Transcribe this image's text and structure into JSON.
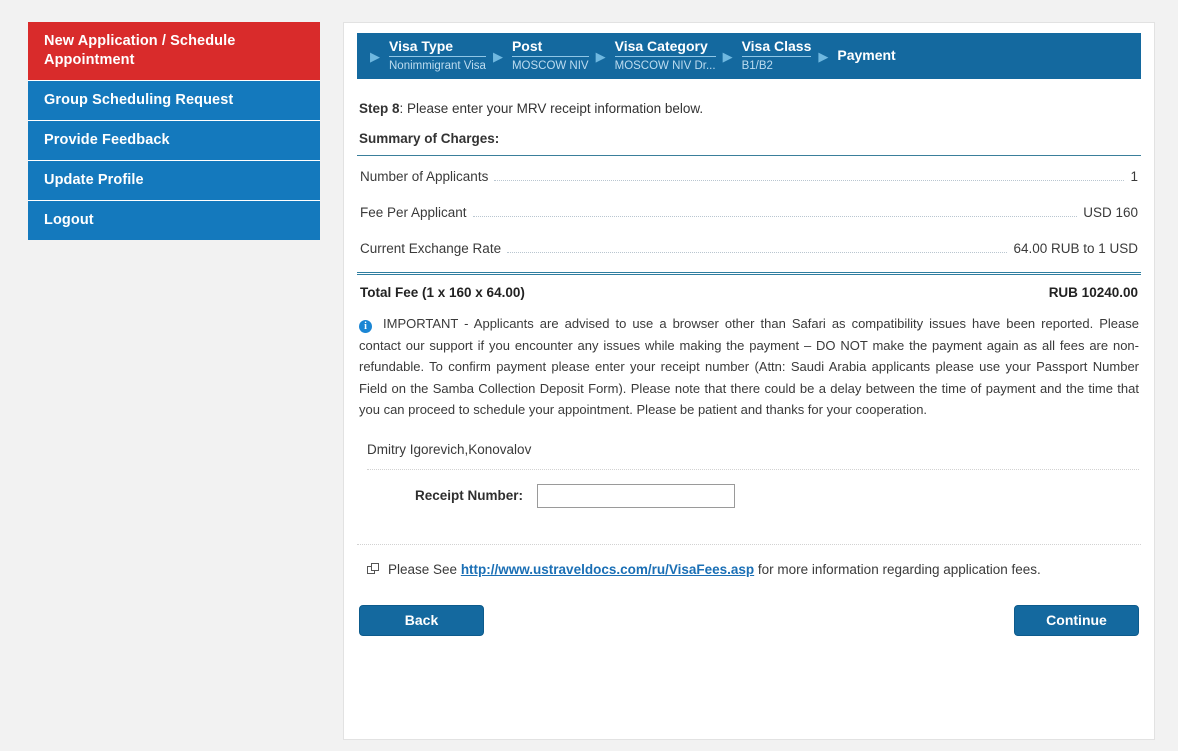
{
  "sidebar": {
    "items": [
      {
        "label": "New Application / Schedule Appointment",
        "active": true
      },
      {
        "label": "Group Scheduling Request",
        "active": false
      },
      {
        "label": "Provide Feedback",
        "active": false
      },
      {
        "label": "Update Profile",
        "active": false
      },
      {
        "label": "Logout",
        "active": false
      }
    ]
  },
  "stepper": {
    "arrow_glyph": "▶",
    "steps": [
      {
        "title": "Visa Type",
        "sub": "Nonimmigrant Visa"
      },
      {
        "title": "Post",
        "sub": "MOSCOW NIV"
      },
      {
        "title": "Visa Category",
        "sub": "MOSCOW NIV Dr..."
      },
      {
        "title": "Visa Class",
        "sub": "B1/B2"
      },
      {
        "title": "Payment",
        "sub": ""
      }
    ]
  },
  "main": {
    "step_label": "Step 8",
    "step_text": ": Please enter your MRV receipt information below.",
    "summary_heading": "Summary of Charges:",
    "charges": [
      {
        "label": "Number of Applicants",
        "value": "1"
      },
      {
        "label": "Fee Per Applicant",
        "value": "USD 160"
      },
      {
        "label": "Current Exchange Rate",
        "value": "64.00 RUB to 1 USD"
      }
    ],
    "total": {
      "label": "Total Fee (1 x 160 x 64.00)",
      "value": "RUB 10240.00"
    },
    "notice_icon": "i",
    "notice_text": "IMPORTANT - Applicants are advised to use a browser other than Safari as compatibility issues have been reported. Please contact our support if you encounter any issues while making the payment – DO NOT make the payment again as all fees are non-refundable. To confirm payment please enter your receipt number (Attn: Saudi Arabia applicants please use your Passport Number Field on the Samba Collection Deposit Form). Please note that there could be a delay between the time of payment and the time that you can proceed to schedule your appointment. Please be patient and thanks for your cooperation.",
    "applicant_name": "Dmitry Igorevich,Konovalov",
    "receipt_label": "Receipt Number:",
    "receipt_value": "",
    "receipt_placeholder": "",
    "link_prefix": "Please See ",
    "link_text": "http://www.ustraveldocs.com/ru/VisaFees.asp",
    "link_suffix": " for more information regarding application fees.",
    "back_label": "Back",
    "continue_label": "Continue"
  },
  "colors": {
    "nav_blue": "#1479bd",
    "nav_red": "#d92b2b",
    "header_blue": "#14699f",
    "link_blue": "#1a6fb5",
    "rule_teal": "#2f7ea0"
  }
}
